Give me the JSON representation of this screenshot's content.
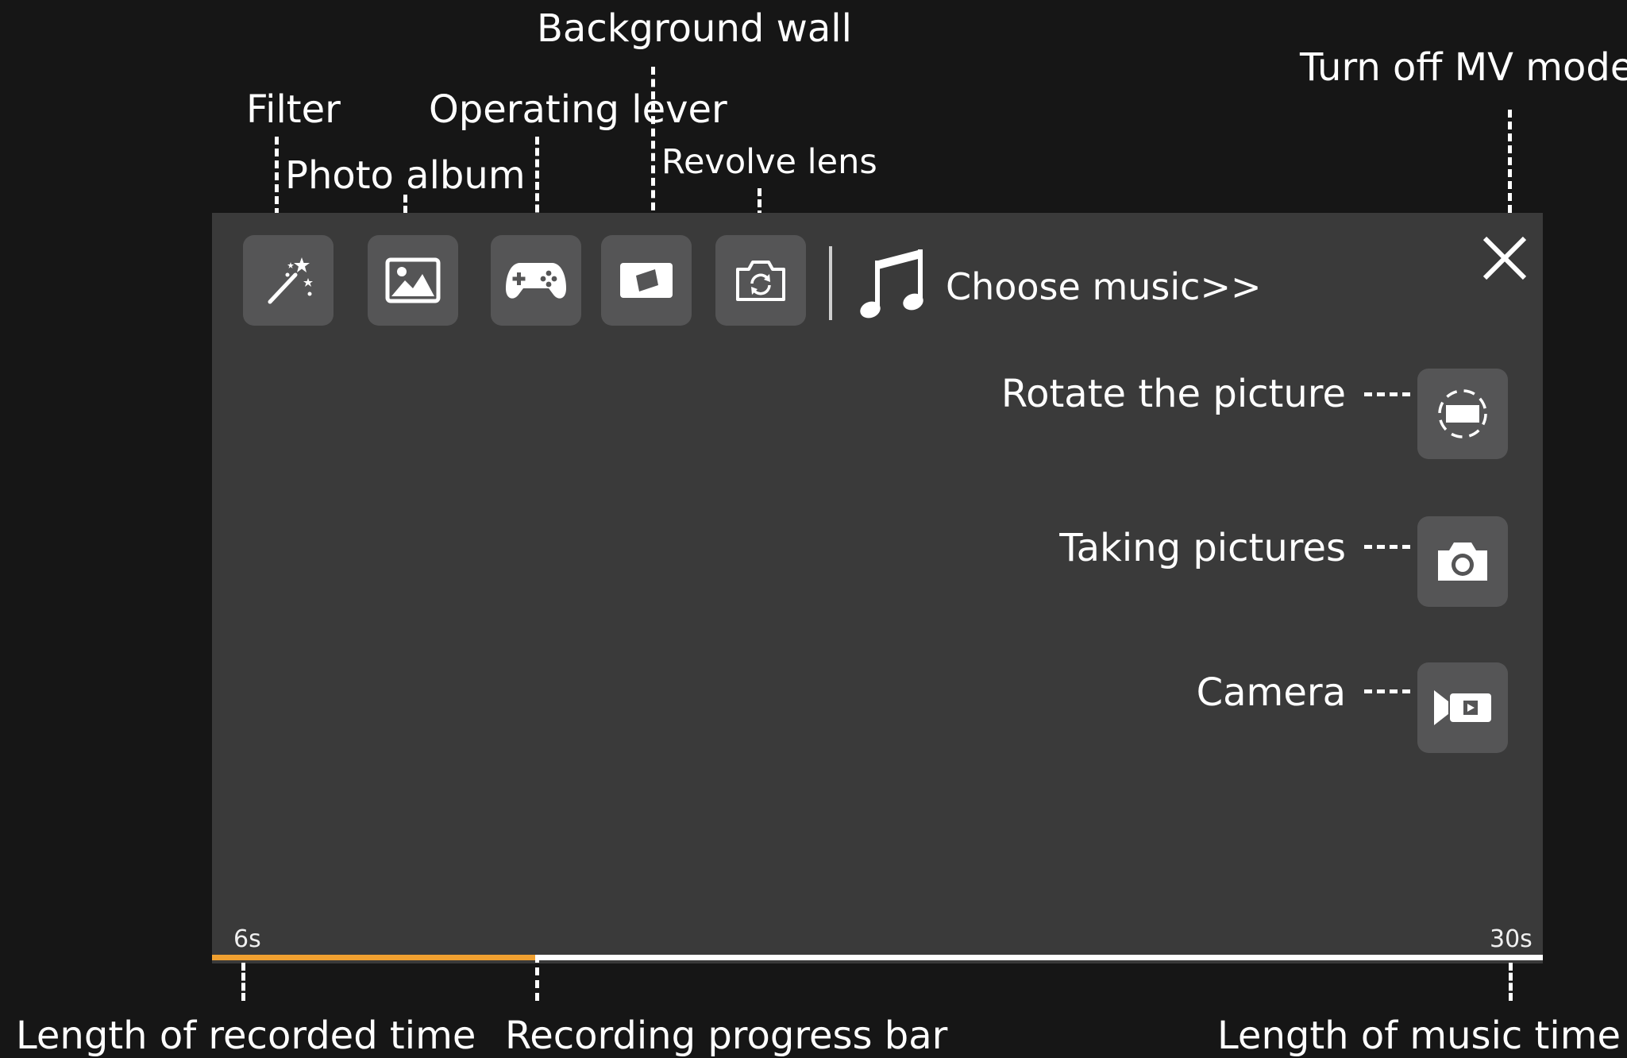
{
  "annotations": {
    "background_wall": "Background wall",
    "turn_off_mv": "Turn off MV mode",
    "filter": "Filter",
    "operating_lever": "Operating lever",
    "photo_album": "Photo album",
    "revolve_lens": "Revolve lens",
    "rotate_picture": "Rotate the picture",
    "taking_pictures": "Taking pictures",
    "camera": "Camera",
    "recorded_time": "Length of recorded time",
    "progress_bar": "Recording progress bar",
    "music_time": "Length of music time"
  },
  "toolbar": {
    "choose_music": "Choose music>>",
    "icons": [
      "magic-wand-icon",
      "image-icon",
      "gamepad-icon",
      "background-wall-icon",
      "switch-camera-icon",
      "music-note-icon",
      "close-icon"
    ]
  },
  "side_buttons": {
    "icons": [
      "rotate-icon",
      "camera-icon",
      "video-camera-icon"
    ]
  },
  "timeline": {
    "min_label": "6s",
    "max_label": "30s",
    "progress": 0.245
  },
  "colors": {
    "background": "#161616",
    "panel": "#3a3a3a",
    "button": "#555556",
    "progress": "#f0a030",
    "track": "#ffffff"
  }
}
